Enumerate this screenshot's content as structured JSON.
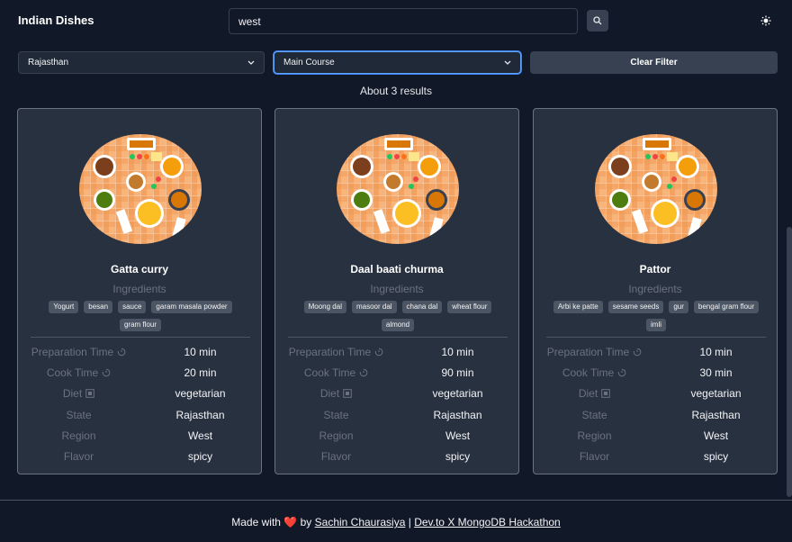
{
  "header": {
    "brand": "Indian Dishes",
    "search_value": "west"
  },
  "filters": {
    "state": "Rajasthan",
    "course": "Main Course",
    "clear_label": "Clear Filter"
  },
  "results_text": "About 3 results",
  "labels": {
    "ingredients": "Ingredients",
    "prep": "Preparation Time",
    "cook": "Cook Time",
    "diet": "Diet",
    "state": "State",
    "region": "Region",
    "flavor": "Flavor"
  },
  "cards": [
    {
      "name": "Gatta curry",
      "ingredients": [
        "Yogurt",
        "besan",
        "sauce",
        "garam masala powder",
        "gram flour"
      ],
      "prep": "10 min",
      "cook": "20 min",
      "diet": "vegetarian",
      "state": "Rajasthan",
      "region": "West",
      "flavor": "spicy"
    },
    {
      "name": "Daal baati churma",
      "ingredients": [
        "Moong dal",
        "masoor dal",
        "chana dal",
        "wheat flour",
        "almond"
      ],
      "prep": "10 min",
      "cook": "90 min",
      "diet": "vegetarian",
      "state": "Rajasthan",
      "region": "West",
      "flavor": "spicy"
    },
    {
      "name": "Pattor",
      "ingredients": [
        "Arbi ke patte",
        "sesame seeds",
        "gur",
        "bengal gram flour",
        "imli"
      ],
      "prep": "10 min",
      "cook": "30 min",
      "diet": "vegetarian",
      "state": "Rajasthan",
      "region": "West",
      "flavor": "spicy"
    }
  ],
  "footer": {
    "prefix": "Made with",
    "heart": "❤️",
    "by": "by",
    "author": "Sachin Chaurasiya",
    "sep": "|",
    "event": "Dev.to X MongoDB Hackathon"
  },
  "icons": {
    "search": "search-icon",
    "theme": "sun-icon",
    "chevron": "chevron-down-icon",
    "timer": "timer-icon",
    "veg": "veg-mark-icon"
  }
}
